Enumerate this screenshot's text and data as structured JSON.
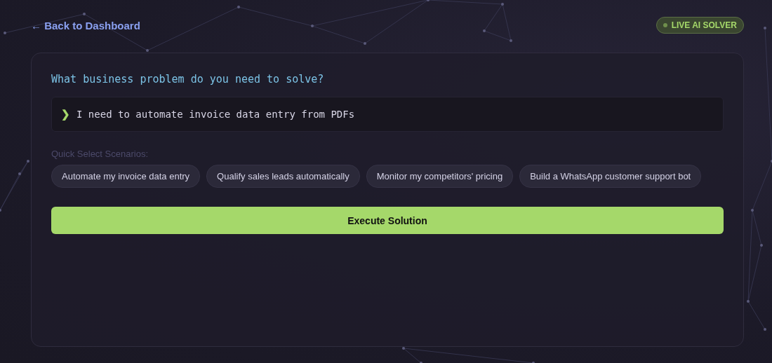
{
  "back_link": "← Back to Dashboard",
  "badge": {
    "label": "LIVE AI SOLVER",
    "on": true
  },
  "prompt": {
    "question": "What business problem do you need to solve?",
    "marker": "❯",
    "value": "I need to automate invoice data entry from PDFs"
  },
  "scenarios": {
    "label": "Quick Select Scenarios:",
    "items": [
      {
        "label": "Automate my invoice data entry"
      },
      {
        "label": "Qualify sales leads automatically"
      },
      {
        "label": "Monitor my competitors' pricing"
      },
      {
        "label": "Build a WhatsApp customer support bot"
      }
    ]
  },
  "execute_button": "Execute Solution"
}
